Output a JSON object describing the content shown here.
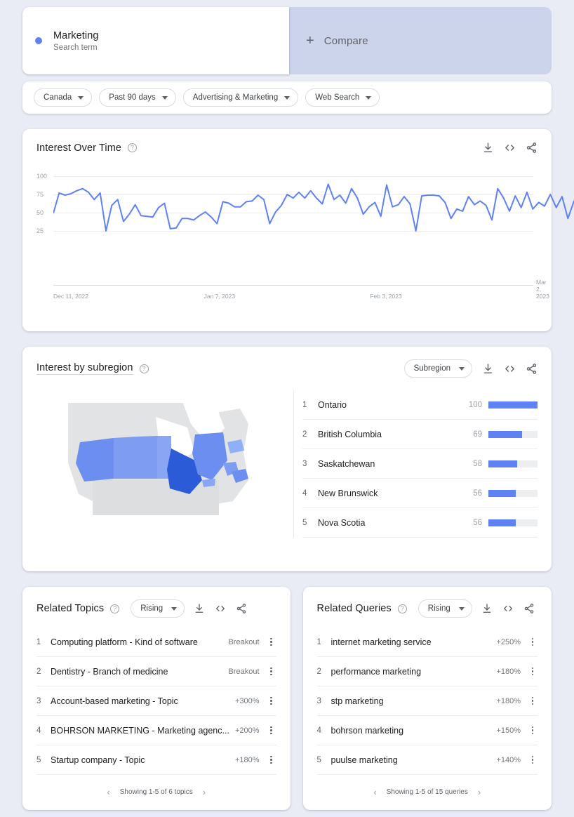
{
  "term": {
    "name": "Marketing",
    "type": "Search term",
    "dot_color": "#5e81f4"
  },
  "compare": {
    "label": "Compare",
    "plus": "+"
  },
  "filters": [
    {
      "label": "Canada"
    },
    {
      "label": "Past 90 days"
    },
    {
      "label": "Advertising & Marketing"
    },
    {
      "label": "Web Search"
    }
  ],
  "interest_over_time": {
    "title": "Interest Over Time",
    "help": "?",
    "actions": [
      "download-icon",
      "embed-icon",
      "share-icon"
    ]
  },
  "subregion": {
    "title": "Interest by subregion",
    "help": "?",
    "selector": "Subregion",
    "rows": [
      {
        "rank": "1",
        "name": "Ontario",
        "value": "100"
      },
      {
        "rank": "2",
        "name": "British Columbia",
        "value": "69"
      },
      {
        "rank": "3",
        "name": "Saskatchewan",
        "value": "58"
      },
      {
        "rank": "4",
        "name": "New Brunswick",
        "value": "56"
      },
      {
        "rank": "5",
        "name": "Nova Scotia",
        "value": "56"
      }
    ]
  },
  "related_topics": {
    "title": "Related Topics",
    "help": "?",
    "selector": "Rising",
    "rows": [
      {
        "rank": "1",
        "label": "Computing platform - Kind of software",
        "value": "Breakout"
      },
      {
        "rank": "2",
        "label": "Dentistry - Branch of medicine",
        "value": "Breakout"
      },
      {
        "rank": "3",
        "label": "Account-based marketing - Topic",
        "value": "+300%"
      },
      {
        "rank": "4",
        "label": "BOHRSON MARKETING - Marketing agenc...",
        "value": "+200%"
      },
      {
        "rank": "5",
        "label": "Startup company - Topic",
        "value": "+180%"
      }
    ],
    "pager": "Showing 1-5 of 6 topics"
  },
  "related_queries": {
    "title": "Related Queries",
    "help": "?",
    "selector": "Rising",
    "rows": [
      {
        "rank": "1",
        "label": "internet marketing service",
        "value": "+250%"
      },
      {
        "rank": "2",
        "label": "performance marketing",
        "value": "+180%"
      },
      {
        "rank": "3",
        "label": "stp marketing",
        "value": "+180%"
      },
      {
        "rank": "4",
        "label": "bohrson marketing",
        "value": "+150%"
      },
      {
        "rank": "5",
        "label": "puulse marketing",
        "value": "+140%"
      }
    ],
    "pager": "Showing 1-5 of 15 queries"
  },
  "chart_data": {
    "type": "line",
    "title": "Interest Over Time",
    "xlabel": "",
    "ylabel": "",
    "ylim": [
      0,
      100
    ],
    "yticks": [
      25,
      50,
      75,
      100
    ],
    "xticks": [
      "Dec 11, 2022",
      "Jan 7, 2023",
      "Feb 3, 2023",
      "Mar 2, 2023"
    ],
    "grid": true,
    "legend": false,
    "series": [
      {
        "name": "Marketing",
        "color": "#5e81f4",
        "values": [
          49,
          77,
          74,
          76,
          80,
          83,
          78,
          68,
          77,
          25,
          60,
          68,
          38,
          48,
          61,
          46,
          45,
          44,
          57,
          63,
          28,
          29,
          42,
          42,
          40,
          46,
          51,
          44,
          35,
          65,
          63,
          58,
          58,
          65,
          66,
          74,
          68,
          35,
          51,
          60,
          75,
          70,
          78,
          70,
          80,
          70,
          62,
          89,
          68,
          74,
          63,
          83,
          70,
          48,
          58,
          64,
          45,
          88,
          58,
          61,
          72,
          62,
          25,
          73,
          74,
          74,
          73,
          64,
          42,
          55,
          52,
          72,
          61,
          66,
          60,
          40,
          83,
          70,
          52,
          73,
          57,
          78,
          55,
          64,
          59,
          75,
          57,
          72,
          42,
          65,
          78
        ]
      }
    ]
  }
}
